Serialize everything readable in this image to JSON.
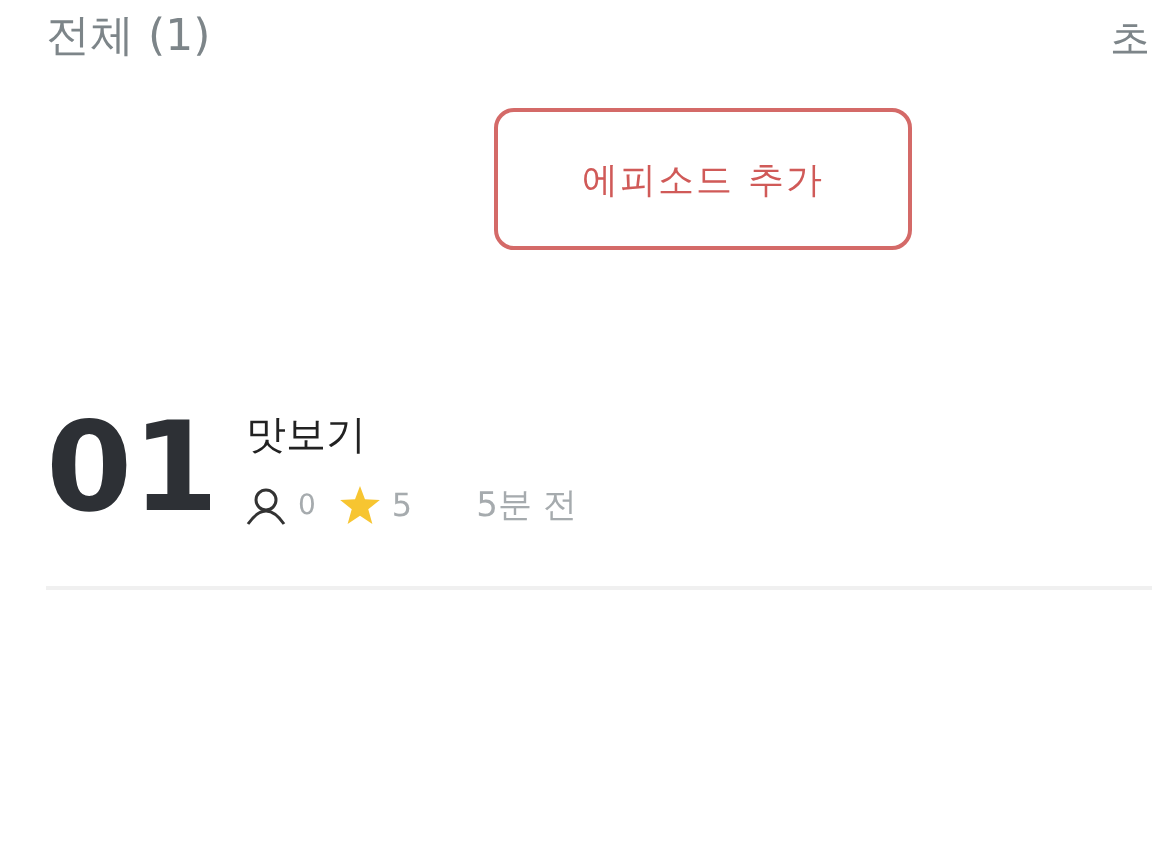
{
  "header": {
    "title": "전체 (1)",
    "right_label": "초"
  },
  "add_button": {
    "label": "에피소드 추가"
  },
  "episodes": [
    {
      "number": "01",
      "title": "맛보기",
      "viewers": "0",
      "rating": "5",
      "time": "5분 전"
    }
  ]
}
